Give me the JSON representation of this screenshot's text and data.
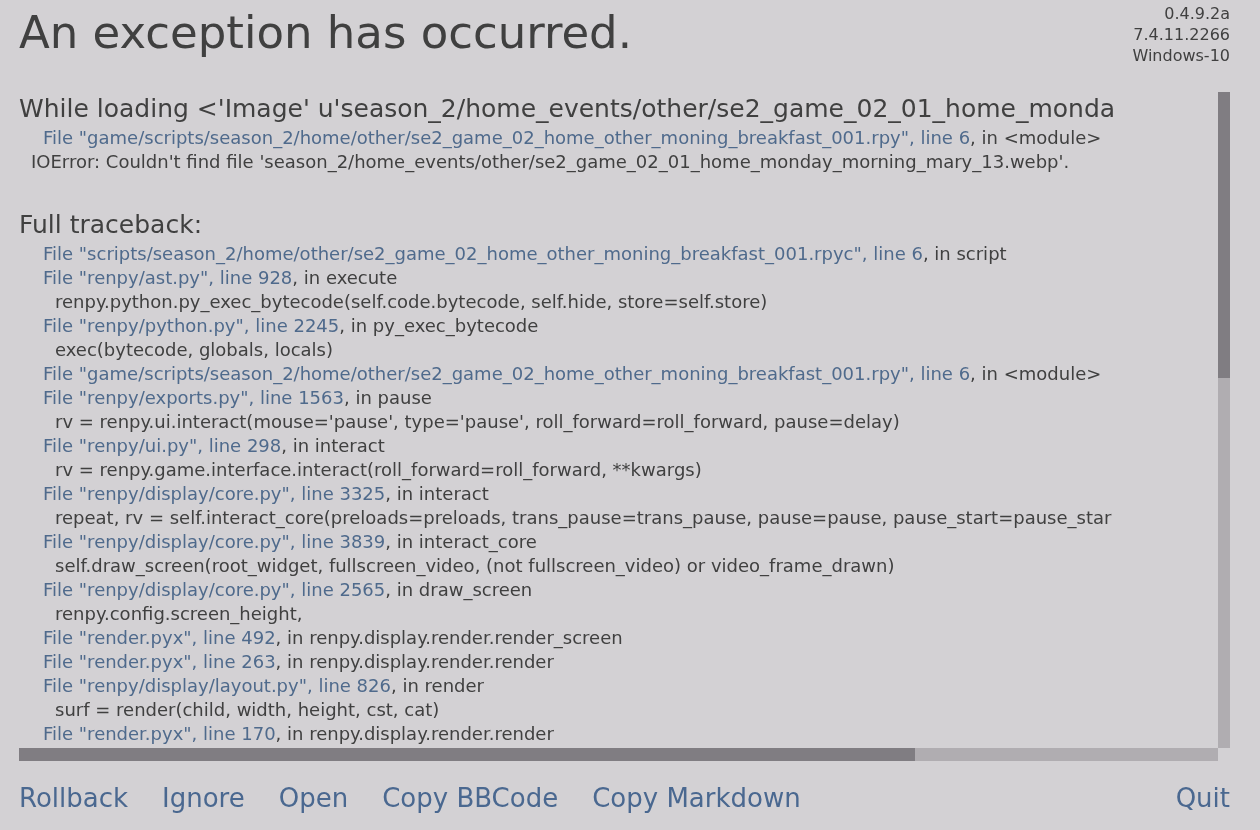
{
  "title": "An exception has occurred.",
  "version_info": [
    "0.4.9.2a",
    "7.4.11.2266",
    "Windows-10"
  ],
  "error": {
    "heading": "While loading <'Image' u'season_2/home_events/other/se2_game_02_01_home_monda",
    "lines": [
      {
        "kind": "file",
        "location": "File \"game/scripts/season_2/home/other/se2_game_02_home_other_moning_breakfast_001.rpy\", line 6",
        "context": ", in <module>"
      },
      {
        "kind": "message",
        "text": "IOError: Couldn't find file 'season_2/home_events/other/se2_game_02_01_home_monday_morning_mary_13.webp'."
      }
    ]
  },
  "traceback": {
    "heading": "Full traceback:",
    "lines": [
      {
        "kind": "file",
        "location": "File \"scripts/season_2/home/other/se2_game_02_home_other_moning_breakfast_001.rpyc\", line 6",
        "context": ", in script"
      },
      {
        "kind": "file",
        "location": "File \"renpy/ast.py\", line 928",
        "context": ", in execute"
      },
      {
        "kind": "code",
        "text": "renpy.python.py_exec_bytecode(self.code.bytecode, self.hide, store=self.store)"
      },
      {
        "kind": "file",
        "location": "File \"renpy/python.py\", line 2245",
        "context": ", in py_exec_bytecode"
      },
      {
        "kind": "code",
        "text": "exec(bytecode, globals, locals)"
      },
      {
        "kind": "file",
        "location": "File \"game/scripts/season_2/home/other/se2_game_02_home_other_moning_breakfast_001.rpy\", line 6",
        "context": ", in <module>"
      },
      {
        "kind": "file",
        "location": "File \"renpy/exports.py\", line 1563",
        "context": ", in pause"
      },
      {
        "kind": "code",
        "text": "rv = renpy.ui.interact(mouse='pause', type='pause', roll_forward=roll_forward, pause=delay)"
      },
      {
        "kind": "file",
        "location": "File \"renpy/ui.py\", line 298",
        "context": ", in interact"
      },
      {
        "kind": "code",
        "text": "rv = renpy.game.interface.interact(roll_forward=roll_forward, **kwargs)"
      },
      {
        "kind": "file",
        "location": "File \"renpy/display/core.py\", line 3325",
        "context": ", in interact"
      },
      {
        "kind": "code",
        "text": "repeat, rv = self.interact_core(preloads=preloads, trans_pause=trans_pause, pause=pause, pause_start=pause_star"
      },
      {
        "kind": "file",
        "location": "File \"renpy/display/core.py\", line 3839",
        "context": ", in interact_core"
      },
      {
        "kind": "code",
        "text": "self.draw_screen(root_widget, fullscreen_video, (not fullscreen_video) or video_frame_drawn)"
      },
      {
        "kind": "file",
        "location": "File \"renpy/display/core.py\", line 2565",
        "context": ", in draw_screen"
      },
      {
        "kind": "code",
        "text": "renpy.config.screen_height,"
      },
      {
        "kind": "file",
        "location": "File \"render.pyx\", line 492",
        "context": ", in renpy.display.render.render_screen"
      },
      {
        "kind": "file",
        "location": "File \"render.pyx\", line 263",
        "context": ", in renpy.display.render.render"
      },
      {
        "kind": "file",
        "location": "File \"renpy/display/layout.py\", line 826",
        "context": ", in render"
      },
      {
        "kind": "code",
        "text": "surf = render(child, width, height, cst, cat)"
      },
      {
        "kind": "file",
        "location": "File \"render.pyx\", line 170",
        "context": ", in renpy.display.render.render"
      }
    ]
  },
  "actions": [
    {
      "label": "Rollback",
      "kind": "left"
    },
    {
      "label": "Ignore",
      "kind": "left"
    },
    {
      "label": "Open",
      "kind": "left"
    },
    {
      "label": "Copy BBCode",
      "kind": "left"
    },
    {
      "label": "Copy Markdown",
      "kind": "left"
    },
    {
      "label": "Quit",
      "kind": "right"
    }
  ]
}
